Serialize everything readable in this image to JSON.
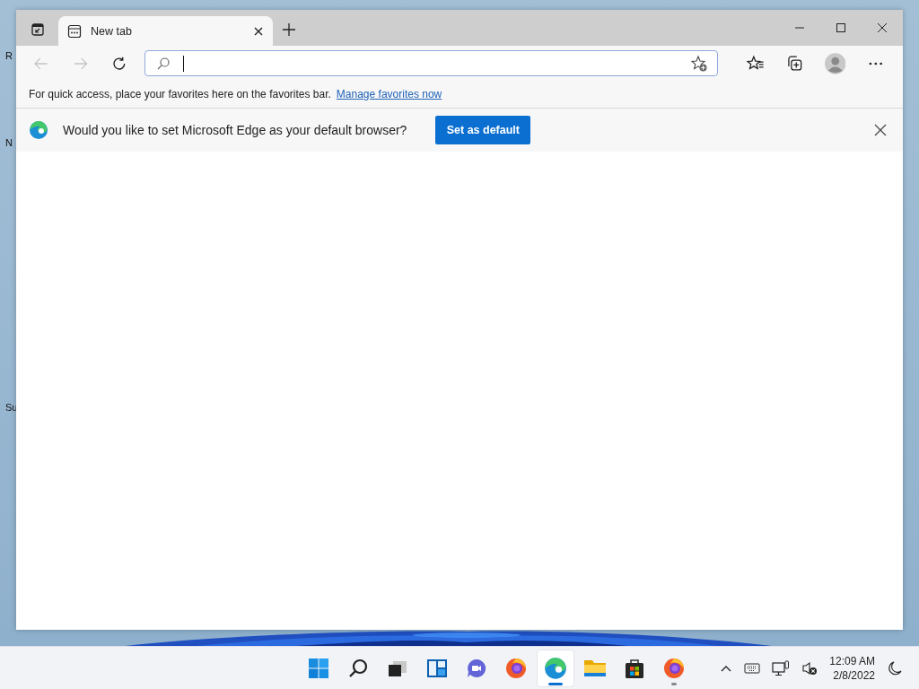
{
  "desktop": {
    "icon_labels": [
      {
        "label": "R"
      },
      {
        "label": "N"
      },
      {
        "label": "Su"
      }
    ]
  },
  "window": {
    "tabs": [
      {
        "title": "New tab",
        "selected": true
      }
    ],
    "toolbar": {
      "back_disabled": true,
      "forward_disabled": true
    },
    "favorites_bar": {
      "message": "For quick access, place your favorites here on the favorites bar.",
      "link": "Manage favorites now"
    },
    "infobar": {
      "message": "Would you like to set Microsoft Edge as your default browser?",
      "button": "Set as default"
    }
  },
  "taskbar": {
    "apps": [
      {
        "kind": "start",
        "running": false,
        "selected": false
      },
      {
        "kind": "search",
        "running": false,
        "selected": false
      },
      {
        "kind": "taskview",
        "running": false,
        "selected": false
      },
      {
        "kind": "widgets",
        "running": false,
        "selected": false
      },
      {
        "kind": "chat",
        "running": false,
        "selected": false
      },
      {
        "kind": "firefox",
        "running": false,
        "selected": false
      },
      {
        "kind": "edge",
        "running": true,
        "selected": true
      },
      {
        "kind": "folder",
        "running": false,
        "selected": false
      },
      {
        "kind": "store",
        "running": false,
        "selected": false
      },
      {
        "kind": "firefox",
        "running": true,
        "selected": false
      }
    ],
    "clock": {
      "time": "12:09 AM",
      "date": "2/8/2022"
    }
  }
}
